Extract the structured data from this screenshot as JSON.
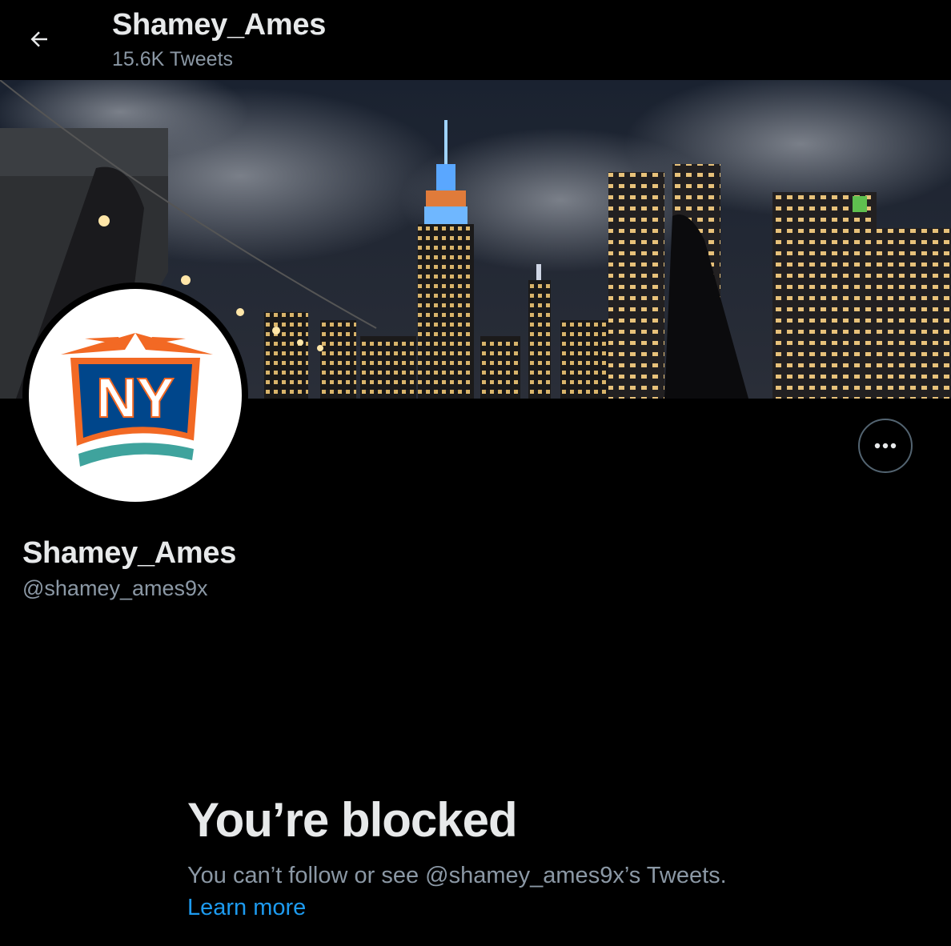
{
  "header": {
    "back_icon": "arrow-left-icon",
    "title": "Shamey_Ames",
    "subtitle": "15.6K Tweets"
  },
  "banner": {
    "description_icon": "city-skyline-photo"
  },
  "profile": {
    "avatar_logo_text": "NY",
    "name": "Shamey_Ames",
    "handle": "@shamey_ames9x",
    "more_icon": "more-horizontal-icon"
  },
  "blocked": {
    "title": "You’re blocked",
    "description": "You can’t follow or see @shamey_ames9x’s Tweets.",
    "learn_more": "Learn more"
  },
  "colors": {
    "background": "#000000",
    "text_primary": "#e7e9ea",
    "text_secondary": "#8b98a5",
    "link": "#1d9bf0",
    "logo_orange": "#f26924",
    "logo_navy": "#00468b",
    "logo_teal": "#3fa39d"
  }
}
